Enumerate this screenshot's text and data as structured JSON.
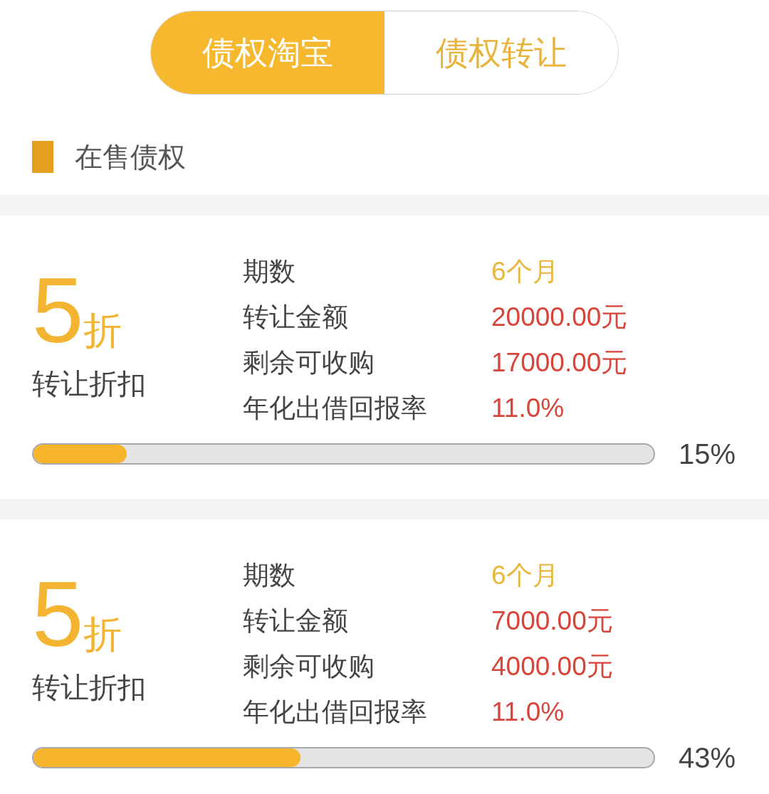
{
  "tabs": [
    {
      "label": "债权淘宝",
      "selected": true
    },
    {
      "label": "债权转让",
      "selected": false
    }
  ],
  "section": {
    "title": "在售债权"
  },
  "listings": [
    {
      "discount": "5",
      "discount_unit": "折",
      "discount_label": "转让折扣",
      "fields": [
        {
          "label": "期数",
          "value": "6个月",
          "kind": "period"
        },
        {
          "label": "转让金额",
          "value": "20000.00元",
          "kind": "amount"
        },
        {
          "label": "剩余可收购",
          "value": "17000.00元",
          "kind": "amount"
        },
        {
          "label": "年化出借回报率",
          "value": "11.0%",
          "kind": "amount"
        }
      ],
      "level": 0.15,
      "reading": "15%"
    },
    {
      "discount": "5",
      "discount_unit": "折",
      "discount_label": "转让折扣",
      "fields": [
        {
          "label": "期数",
          "value": "6个月",
          "kind": "period"
        },
        {
          "label": "转让金额",
          "value": "7000.00元",
          "kind": "amount"
        },
        {
          "label": "剩余可收购",
          "value": "4000.00元",
          "kind": "amount"
        },
        {
          "label": "年化出借回报率",
          "value": "11.0%",
          "kind": "amount"
        }
      ],
      "level": 0.43,
      "reading": "43%"
    }
  ]
}
